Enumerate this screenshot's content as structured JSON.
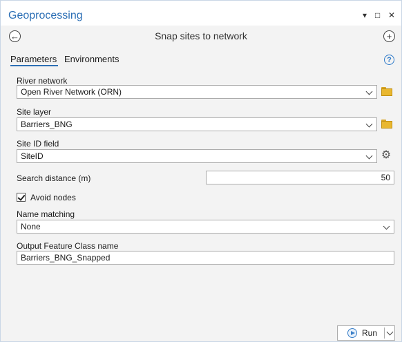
{
  "app": {
    "title": "Geoprocessing"
  },
  "window_controls": {
    "menu": "▾",
    "maximize": "□",
    "close": "✕"
  },
  "tool": {
    "title": "Snap sites to network"
  },
  "tabs": [
    {
      "label": "Parameters",
      "active": true
    },
    {
      "label": "Environments",
      "active": false
    }
  ],
  "params": {
    "river_network": {
      "label": "River network",
      "value": "Open River Network (ORN)"
    },
    "site_layer": {
      "label": "Site layer",
      "value": "Barriers_BNG"
    },
    "site_id_field": {
      "label": "Site ID field",
      "value": "SiteID"
    },
    "search_distance": {
      "label": "Search distance (m)",
      "value": "50"
    },
    "avoid_nodes": {
      "label": "Avoid nodes",
      "checked": true
    },
    "name_matching": {
      "label": "Name matching",
      "value": "None"
    },
    "output_fc": {
      "label": "Output Feature Class name",
      "value": "Barriers_BNG_Snapped"
    }
  },
  "run": {
    "label": "Run"
  },
  "icons": {
    "back": "back-arrow-icon",
    "add": "plus-circle-icon",
    "help": "help-icon",
    "folder": "folder-icon",
    "gear": "gear-icon",
    "dropdown": "chevron-down-icon",
    "run": "play-icon"
  },
  "colors": {
    "accent": "#2c6fb5",
    "folder": "#e9b72f",
    "background": "#f3f3f3"
  }
}
